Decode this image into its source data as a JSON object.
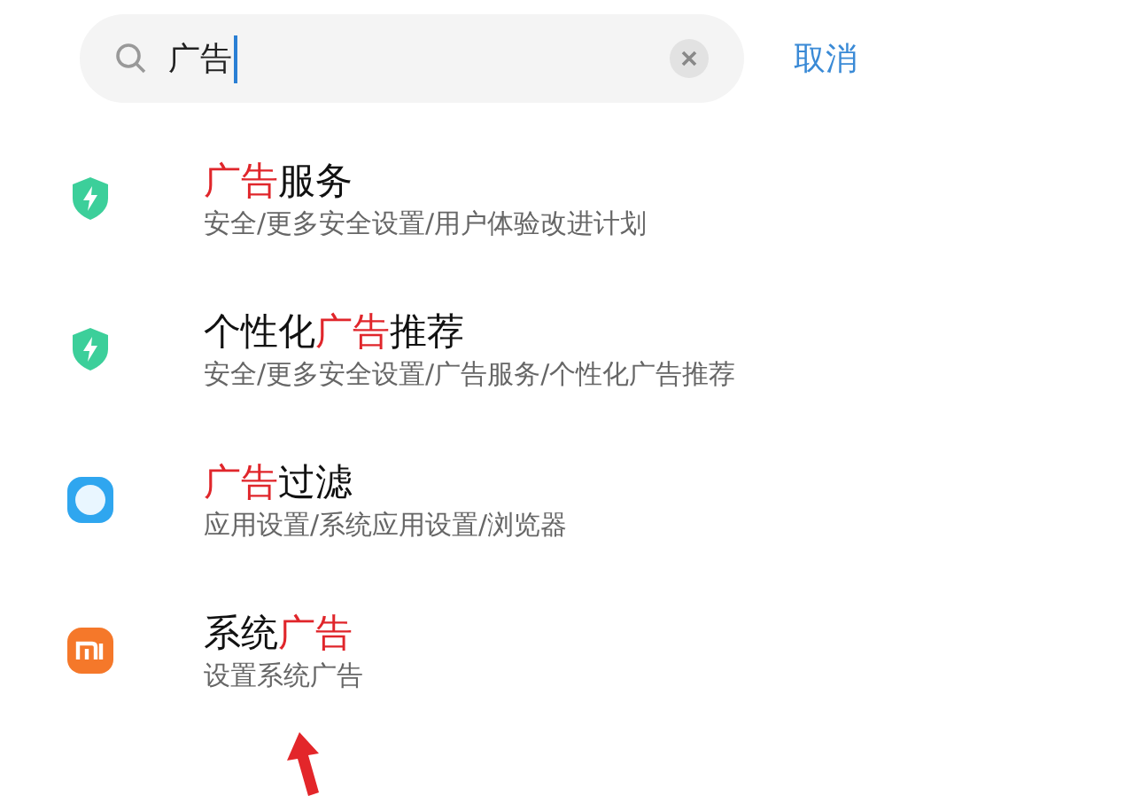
{
  "search": {
    "value": "广告",
    "cancel": "取消"
  },
  "results": [
    {
      "kind": "shield",
      "title": [
        {
          "text": "广告",
          "highlight": true
        },
        {
          "text": "服务",
          "highlight": false
        }
      ],
      "path": "安全/更多安全设置/用户体验改进计划"
    },
    {
      "kind": "shield",
      "title": [
        {
          "text": "个性化",
          "highlight": false
        },
        {
          "text": "广告",
          "highlight": true
        },
        {
          "text": "推荐",
          "highlight": false
        }
      ],
      "path": "安全/更多安全设置/广告服务/个性化广告推荐"
    },
    {
      "kind": "browser",
      "title": [
        {
          "text": "广告",
          "highlight": true
        },
        {
          "text": "过滤",
          "highlight": false
        }
      ],
      "path": "应用设置/系统应用设置/浏览器"
    },
    {
      "kind": "mi",
      "title": [
        {
          "text": "系统",
          "highlight": false
        },
        {
          "text": "广告",
          "highlight": true
        }
      ],
      "path": "设置系统广告"
    }
  ]
}
